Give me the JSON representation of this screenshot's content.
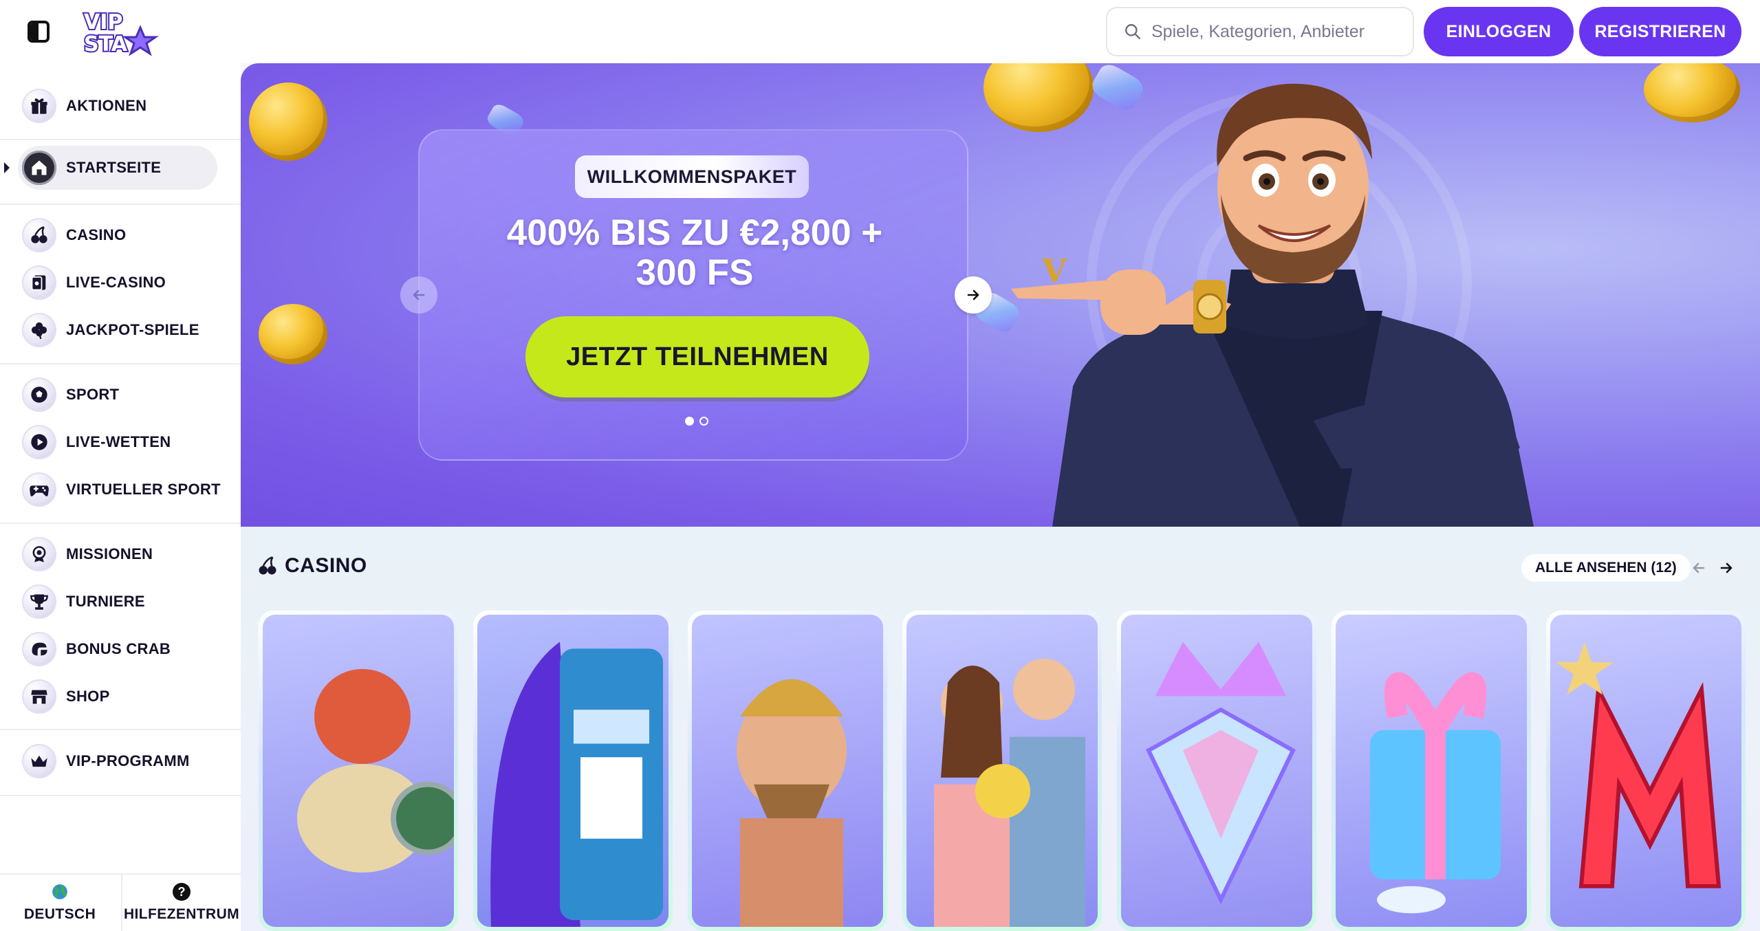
{
  "topbar": {
    "logo_text": "VIP STAR",
    "search_placeholder": "Spiele, Kategorien, Anbieter",
    "login_label": "EINLOGGEN",
    "register_label": "REGISTRIEREN"
  },
  "sidebar": {
    "items": [
      {
        "label": "AKTIONEN",
        "icon": "gift-icon"
      },
      {
        "label": "STARTSEITE",
        "icon": "home-icon",
        "active": true
      },
      {
        "label": "CASINO",
        "icon": "cherries-icon"
      },
      {
        "label": "LIVE-CASINO",
        "icon": "cards-icon"
      },
      {
        "label": "JACKPOT-SPIELE",
        "icon": "clover-icon"
      },
      {
        "label": "SPORT",
        "icon": "soccer-ball-icon"
      },
      {
        "label": "LIVE-WETTEN",
        "icon": "play-icon"
      },
      {
        "label": "VIRTUELLER SPORT",
        "icon": "gamepad-icon"
      },
      {
        "label": "MISSIONEN",
        "icon": "target-icon"
      },
      {
        "label": "TURNIERE",
        "icon": "trophy-icon"
      },
      {
        "label": "BONUS CRAB",
        "icon": "crab-claw-icon"
      },
      {
        "label": "SHOP",
        "icon": "shop-icon"
      },
      {
        "label": "VIP-PROGRAMM",
        "icon": "crown-icon"
      }
    ],
    "language_label": "DEUTSCH",
    "help_label": "HILFEZENTRUM"
  },
  "hero": {
    "badge": "WILLKOMMENSPAKET",
    "headline_line1": "400% BIS ZU €2,800 +",
    "headline_line2": "300 FS",
    "cta_label": "JETZT TEILNEHMEN",
    "slide_count": 2,
    "active_slide": 1
  },
  "casino": {
    "title": "CASINO",
    "see_all_label": "ALLE ANSEHEN (12)",
    "games": [
      {
        "name": "viking-game-tile",
        "colors": [
          "#8f8cf0",
          "#c2c6ff"
        ]
      },
      {
        "name": "slot-machine-game-tile",
        "colors": [
          "#7f86f0",
          "#b6bdfd"
        ]
      },
      {
        "name": "zeus-game-tile",
        "colors": [
          "#8d86f2",
          "#c0c4ff"
        ]
      },
      {
        "name": "couple-flowers-game-tile",
        "colors": [
          "#8c8bf3",
          "#c5c9ff"
        ]
      },
      {
        "name": "diamond-crown-game-tile",
        "colors": [
          "#9491f2",
          "#c7caff"
        ]
      },
      {
        "name": "gift-box-game-tile",
        "colors": [
          "#8f8ef4",
          "#c9cdff"
        ]
      },
      {
        "name": "letter-m-game-tile",
        "colors": [
          "#8e8df4",
          "#c8ccff"
        ]
      }
    ]
  },
  "colors": {
    "accent": "#6a35f0",
    "cta": "#c5e81a"
  }
}
